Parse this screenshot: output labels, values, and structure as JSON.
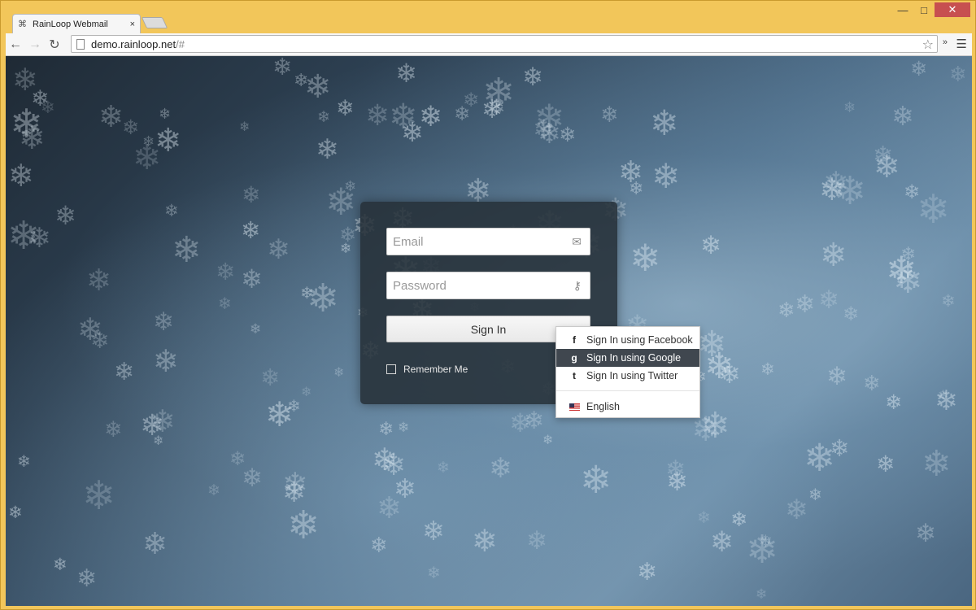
{
  "browser": {
    "tab_title": "RainLoop Webmail",
    "tab_close": "×",
    "url_host": "demo.rainloop.net",
    "url_rest": "/#",
    "window_controls": {
      "minimize": "—",
      "maximize": "□",
      "close": "✕"
    },
    "nav": {
      "back": "←",
      "forward": "→",
      "reload": "↻"
    },
    "star": "☆",
    "extensions": "»",
    "menu": "☰"
  },
  "login": {
    "email_placeholder": "Email",
    "password_placeholder": "Password",
    "sign_in_label": "Sign In",
    "remember_me_label": "Remember Me",
    "options_button": "☰"
  },
  "dropdown": {
    "items": [
      {
        "label": "Sign In using Facebook",
        "icon": "f"
      },
      {
        "label": "Sign In using Google",
        "icon": "g"
      },
      {
        "label": "Sign In using Twitter",
        "icon": "t"
      }
    ],
    "language": "English"
  },
  "colors": {
    "panel_bg": "#263038",
    "dropdown_active": "#40474f",
    "window_frame": "#f2c65a"
  }
}
